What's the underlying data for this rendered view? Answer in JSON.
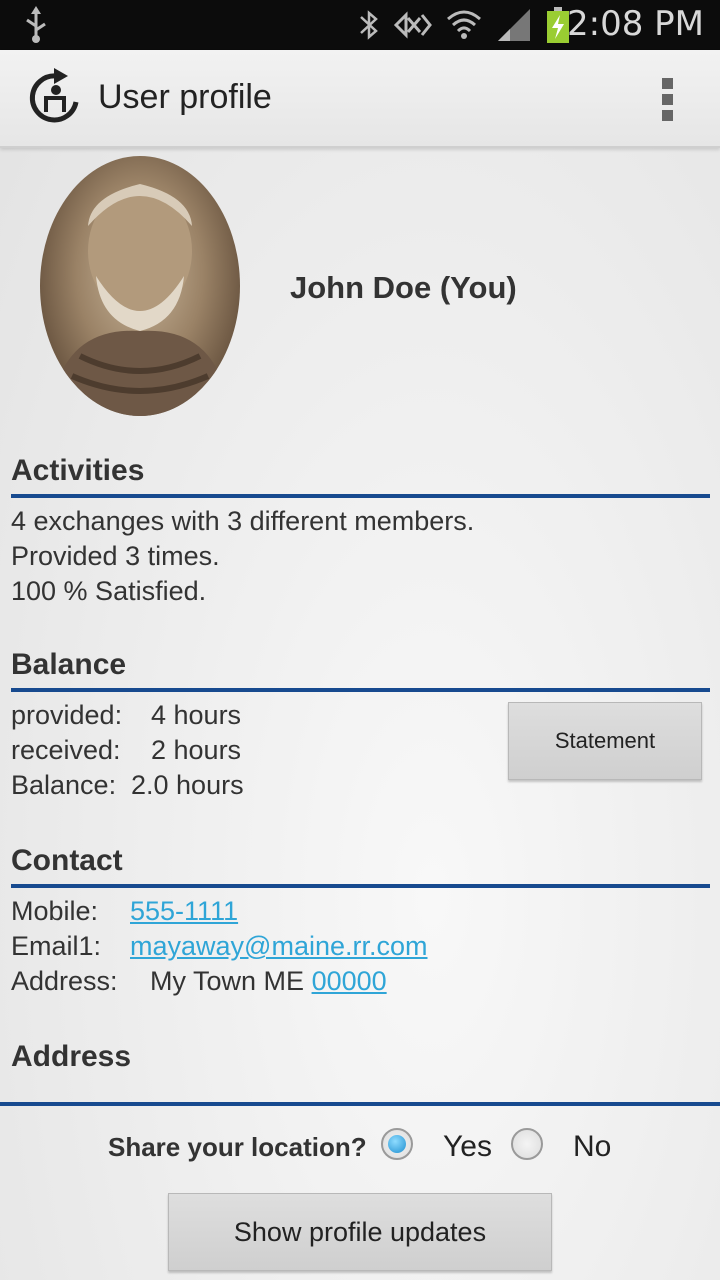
{
  "status_bar": {
    "time": "2:08 PM",
    "icons": [
      "usb-icon",
      "bluetooth-icon",
      "nfc-icon",
      "wifi-icon",
      "signal-icon",
      "battery-charging-icon"
    ]
  },
  "action_bar": {
    "title": "User profile",
    "app_icon": "app-logo-icon",
    "overflow_icon": "overflow-menu-icon"
  },
  "profile": {
    "name": "John Doe (You)"
  },
  "activities": {
    "heading": "Activities",
    "lines": [
      "4 exchanges with 3 different members.",
      "Provided 3 times.",
      "100 % Satisfied."
    ]
  },
  "balance": {
    "heading": "Balance",
    "rows": [
      {
        "label": "provided:",
        "value": "4 hours"
      },
      {
        "label": "received:",
        "value": "2 hours"
      },
      {
        "label": "Balance:",
        "value": "2.0 hours"
      }
    ],
    "statement_button": "Statement"
  },
  "contact": {
    "heading": "Contact",
    "mobile_label": "Mobile:",
    "mobile_value": "555-1111",
    "email_label": "Email1:",
    "email_value": "mayaway@maine.rr.com",
    "address_label": "Address:",
    "address_text": "My Town ME",
    "address_zip": "00000"
  },
  "address": {
    "heading": "Address"
  },
  "share_location": {
    "question": "Share your location?",
    "yes_label": "Yes",
    "no_label": "No",
    "selected": "Yes"
  },
  "updates_button": "Show profile updates",
  "colors": {
    "accent_rule": "#174a8f",
    "link": "#2fa5d7",
    "radio_selected": "#1f8fd0"
  }
}
